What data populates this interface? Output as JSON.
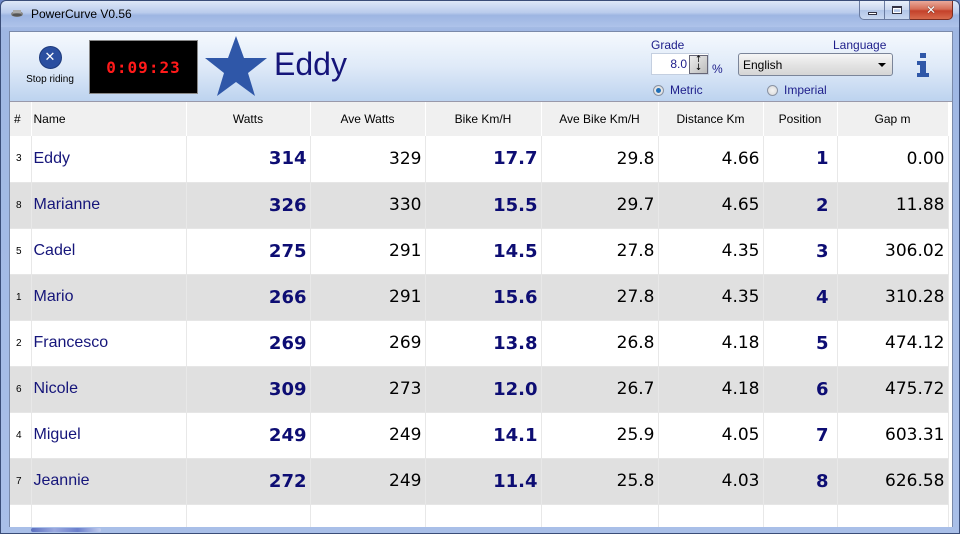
{
  "window": {
    "title": "PowerCurve V0.56",
    "controls": {
      "minimize": "minimize",
      "maximize": "maximize",
      "close": "close"
    }
  },
  "toolbar": {
    "stop_label": "Stop riding",
    "timer": "0:09:23",
    "current_rider": "Eddy",
    "grade": {
      "label": "Grade",
      "value": "8.0",
      "unit": "%"
    },
    "units": {
      "metric_label": "Metric",
      "imperial_label": "Imperial",
      "selected": "Metric"
    },
    "language": {
      "label": "Language",
      "selected": "English"
    }
  },
  "colors": {
    "name_text": "#15157a",
    "bold_value": "#0d0d73",
    "timer_text": "#ff1a1a",
    "star": "#2f57a8",
    "alt_row": "#e0e0e0"
  },
  "table": {
    "columns": [
      "#",
      "Name",
      "Watts",
      "Ave Watts",
      "Bike Km/H",
      "Ave Bike Km/H",
      "Distance Km",
      "Position",
      "Gap m"
    ],
    "rows": [
      {
        "num": "3",
        "name": "Eddy",
        "watts": "314",
        "ave_watts": "329",
        "bike_kmh": "17.7",
        "ave_bike_kmh": "29.8",
        "distance_km": "4.66",
        "position": "1",
        "gap_m": "0.00"
      },
      {
        "num": "8",
        "name": "Marianne",
        "watts": "326",
        "ave_watts": "330",
        "bike_kmh": "15.5",
        "ave_bike_kmh": "29.7",
        "distance_km": "4.65",
        "position": "2",
        "gap_m": "11.88"
      },
      {
        "num": "5",
        "name": "Cadel",
        "watts": "275",
        "ave_watts": "291",
        "bike_kmh": "14.5",
        "ave_bike_kmh": "27.8",
        "distance_km": "4.35",
        "position": "3",
        "gap_m": "306.02"
      },
      {
        "num": "1",
        "name": "Mario",
        "watts": "266",
        "ave_watts": "291",
        "bike_kmh": "15.6",
        "ave_bike_kmh": "27.8",
        "distance_km": "4.35",
        "position": "4",
        "gap_m": "310.28"
      },
      {
        "num": "2",
        "name": "Francesco",
        "watts": "269",
        "ave_watts": "269",
        "bike_kmh": "13.8",
        "ave_bike_kmh": "26.8",
        "distance_km": "4.18",
        "position": "5",
        "gap_m": "474.12"
      },
      {
        "num": "6",
        "name": "Nicole",
        "watts": "309",
        "ave_watts": "273",
        "bike_kmh": "12.0",
        "ave_bike_kmh": "26.7",
        "distance_km": "4.18",
        "position": "6",
        "gap_m": "475.72"
      },
      {
        "num": "4",
        "name": "Miguel",
        "watts": "249",
        "ave_watts": "249",
        "bike_kmh": "14.1",
        "ave_bike_kmh": "25.9",
        "distance_km": "4.05",
        "position": "7",
        "gap_m": "603.31"
      },
      {
        "num": "7",
        "name": "Jeannie",
        "watts": "272",
        "ave_watts": "249",
        "bike_kmh": "11.4",
        "ave_bike_kmh": "25.8",
        "distance_km": "4.03",
        "position": "8",
        "gap_m": "626.58"
      }
    ]
  }
}
